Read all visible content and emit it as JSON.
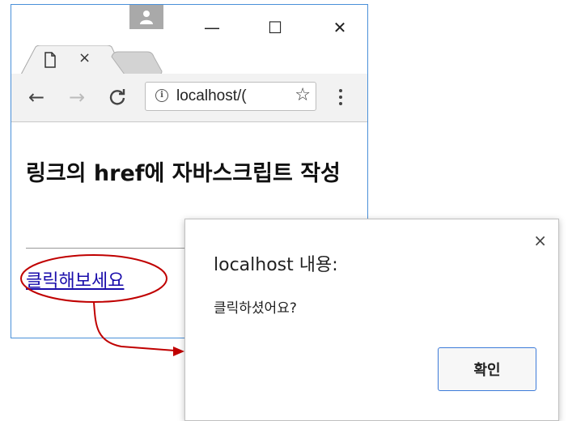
{
  "browser": {
    "tab": {
      "close_glyph": "×",
      "icon": "page-icon"
    },
    "window_controls": {
      "minimize": "—",
      "maximize": "☐",
      "close": "✕"
    },
    "toolbar": {
      "back_glyph": "←",
      "forward_glyph": "→",
      "reload_glyph": "C",
      "url": "localhost/(",
      "star_glyph": "☆"
    },
    "page": {
      "heading": "링크의 href에 자바스크립트 작성",
      "link_text": "클릭해보세요"
    }
  },
  "dialog": {
    "title": "localhost 내용:",
    "message": "클릭하셨어요?",
    "ok_label": "확인",
    "close_glyph": "×"
  },
  "colors": {
    "link": "#1a0dab",
    "annotation": "#c00000",
    "ok_border": "#3d7bd9",
    "window_border": "#4a90d9"
  }
}
